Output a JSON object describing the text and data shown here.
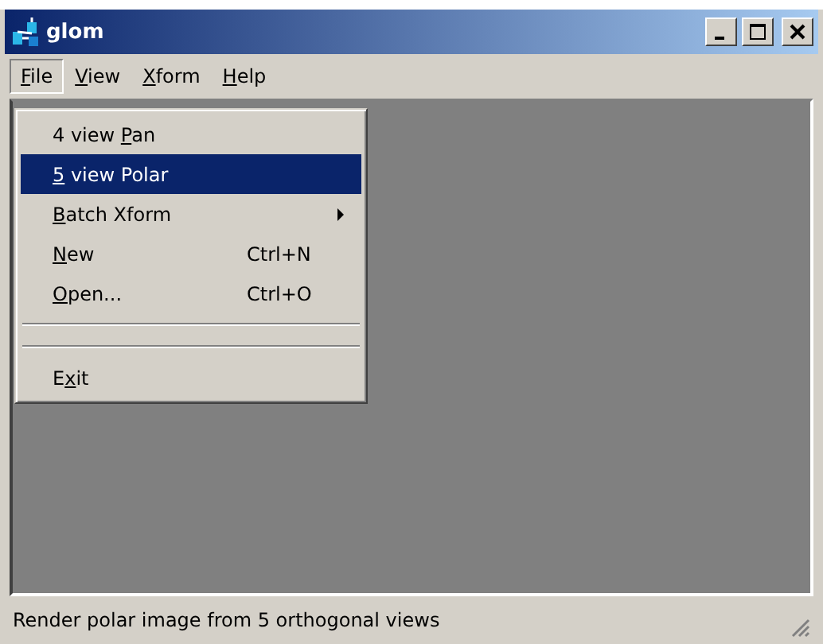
{
  "window": {
    "title": "glom"
  },
  "menu_bar": [
    {
      "key": "F",
      "after": "ile",
      "selected": true
    },
    {
      "key": "V",
      "after": "iew",
      "selected": false
    },
    {
      "key": "X",
      "after": "form",
      "selected": false
    },
    {
      "key": "H",
      "after": "elp",
      "selected": false
    }
  ],
  "file_menu": [
    {
      "kind": "item",
      "before": "4 view ",
      "key": "P",
      "after": "an",
      "selected": false
    },
    {
      "kind": "item",
      "key": "5",
      "after": " view Polar",
      "selected": true
    },
    {
      "kind": "submenu",
      "key": "B",
      "after": "atch Xform",
      "selected": false
    },
    {
      "kind": "item",
      "key": "N",
      "after": "ew",
      "shortcut": "Ctrl+N",
      "selected": false
    },
    {
      "kind": "item",
      "key": "O",
      "after": "pen...",
      "shortcut": "Ctrl+O",
      "selected": false
    },
    {
      "kind": "separator"
    },
    {
      "kind": "separator"
    },
    {
      "kind": "item",
      "before": "E",
      "key": "x",
      "after": "it",
      "selected": false
    }
  ],
  "status_bar": "Render polar image from 5 orthogonal views"
}
